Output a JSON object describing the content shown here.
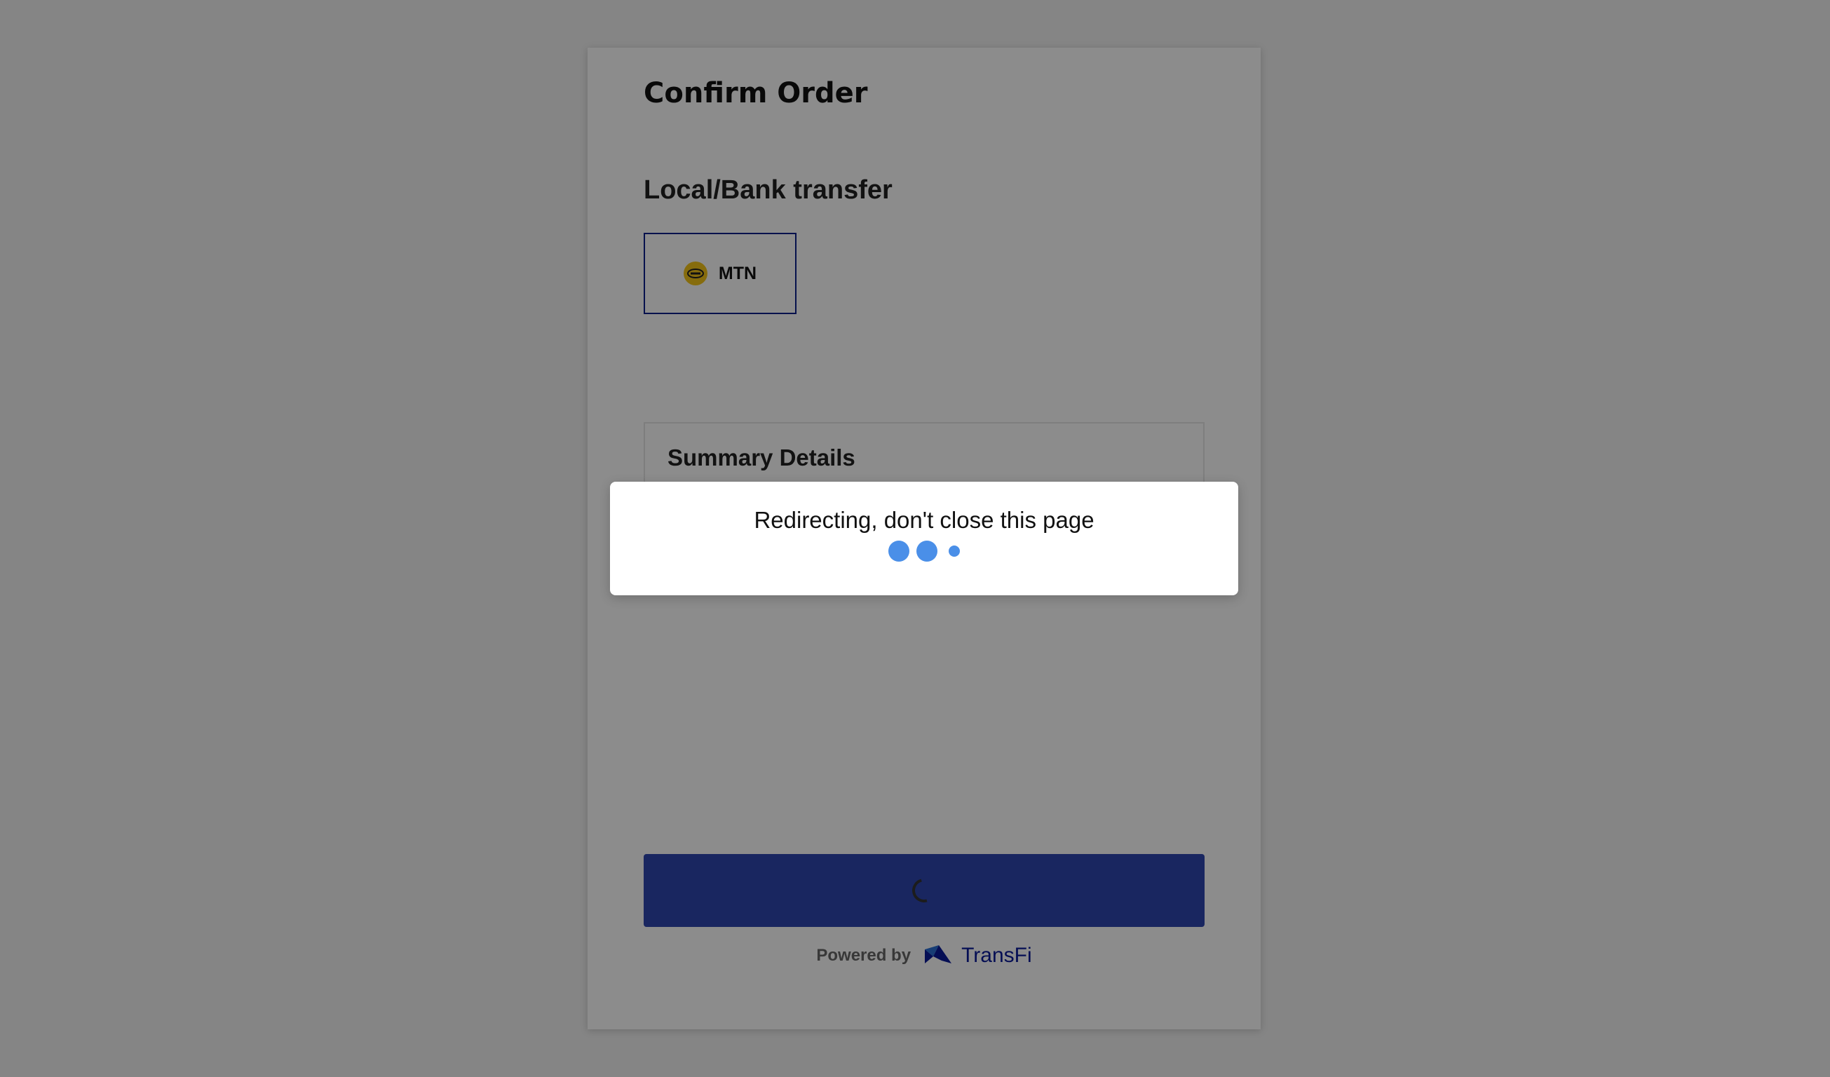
{
  "order": {
    "title": "Confirm Order",
    "payment_method_heading": "Local/Bank transfer",
    "selected_method": {
      "label": "MTN",
      "icon": "mtn-logo-icon"
    },
    "summary": {
      "title": "Summary Details"
    },
    "submit_state": "loading",
    "footer": {
      "powered_by": "Powered by",
      "brand": "TransFi",
      "brand_icon": "transfi-logo-icon"
    }
  },
  "modal": {
    "message": "Redirecting, don't close this page",
    "loader": "three-dot-loader"
  },
  "colors": {
    "accent": "#2f46b0",
    "brand": "#0a1a9a",
    "loader": "#4a8fe8",
    "mtn_yellow": "#f5c518"
  }
}
